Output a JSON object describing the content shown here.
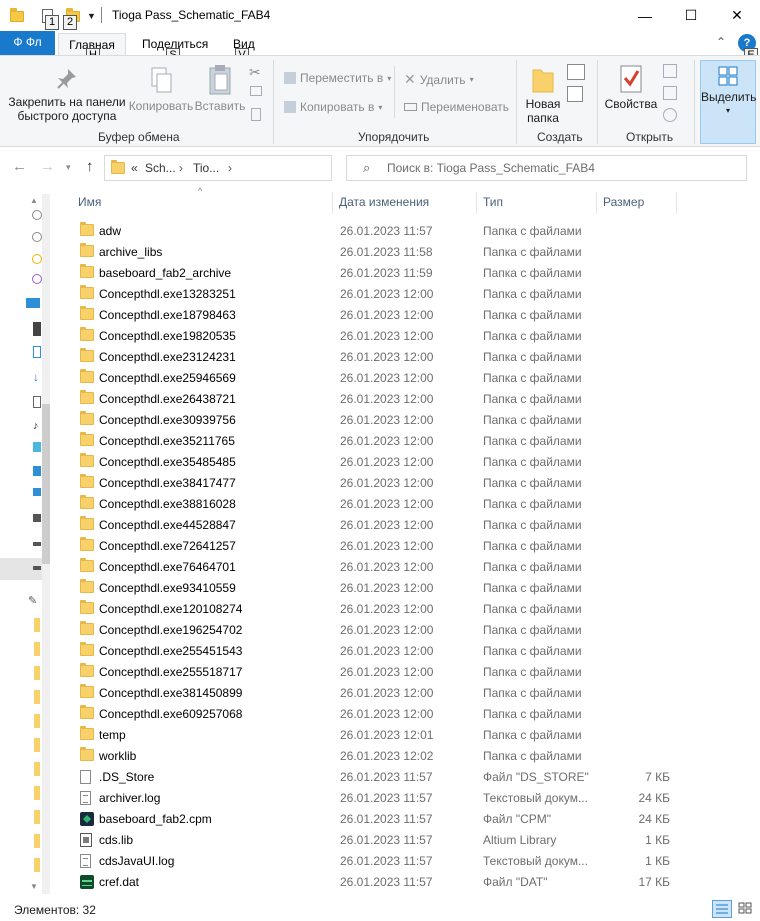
{
  "window": {
    "title": "Tioga Pass_Schematic_FAB4",
    "keytips": [
      "1",
      "2"
    ],
    "minimize": "—",
    "maximize": "☐",
    "close": "✕"
  },
  "ribbon_tabs": {
    "file": "Ф Фл",
    "home": "Главная",
    "home_key": "H",
    "share": "Поделиться",
    "share_key": "S",
    "view": "Вид",
    "view_key": "V",
    "help_key": "E"
  },
  "ribbon": {
    "pin": "Закрепить на панели быстрого доступа",
    "copy": "Копировать",
    "paste": "Вставить",
    "clipboard_group": "Буфер обмена",
    "move_to": "Переместить в",
    "copy_to": "Копировать в",
    "delete": "Удалить",
    "rename": "Переименовать",
    "organize_group": "Упорядочить",
    "new_folder": "Новая папка",
    "create_group": "Создать",
    "properties": "Свойства",
    "open_group": "Открыть",
    "select": "Выделить"
  },
  "navigation": {
    "breadcrumb_overflow": "«",
    "crumbs": [
      "Sch...",
      "Tio..."
    ],
    "search_placeholder": "Поиск в: Tioga Pass_Schematic_FAB4"
  },
  "columns": {
    "name": "Имя",
    "date": "Дата изменения",
    "type": "Тип",
    "size": "Размер"
  },
  "files": [
    {
      "name": "adw",
      "date": "26.01.2023 11:57",
      "type": "Папка с файлами",
      "size": "",
      "icon": "folder"
    },
    {
      "name": "archive_libs",
      "date": "26.01.2023 11:58",
      "type": "Папка с файлами",
      "size": "",
      "icon": "folder"
    },
    {
      "name": "baseboard_fab2_archive",
      "date": "26.01.2023 11:59",
      "type": "Папка с файлами",
      "size": "",
      "icon": "folder"
    },
    {
      "name": "Concepthdl.exe13283251",
      "date": "26.01.2023 12:00",
      "type": "Папка с файлами",
      "size": "",
      "icon": "folder"
    },
    {
      "name": "Concepthdl.exe18798463",
      "date": "26.01.2023 12:00",
      "type": "Папка с файлами",
      "size": "",
      "icon": "folder"
    },
    {
      "name": "Concepthdl.exe19820535",
      "date": "26.01.2023 12:00",
      "type": "Папка с файлами",
      "size": "",
      "icon": "folder"
    },
    {
      "name": "Concepthdl.exe23124231",
      "date": "26.01.2023 12:00",
      "type": "Папка с файлами",
      "size": "",
      "icon": "folder"
    },
    {
      "name": "Concepthdl.exe25946569",
      "date": "26.01.2023 12:00",
      "type": "Папка с файлами",
      "size": "",
      "icon": "folder"
    },
    {
      "name": "Concepthdl.exe26438721",
      "date": "26.01.2023 12:00",
      "type": "Папка с файлами",
      "size": "",
      "icon": "folder"
    },
    {
      "name": "Concepthdl.exe30939756",
      "date": "26.01.2023 12:00",
      "type": "Папка с файлами",
      "size": "",
      "icon": "folder"
    },
    {
      "name": "Concepthdl.exe35211765",
      "date": "26.01.2023 12:00",
      "type": "Папка с файлами",
      "size": "",
      "icon": "folder"
    },
    {
      "name": "Concepthdl.exe35485485",
      "date": "26.01.2023 12:00",
      "type": "Папка с файлами",
      "size": "",
      "icon": "folder"
    },
    {
      "name": "Concepthdl.exe38417477",
      "date": "26.01.2023 12:00",
      "type": "Папка с файлами",
      "size": "",
      "icon": "folder"
    },
    {
      "name": "Concepthdl.exe38816028",
      "date": "26.01.2023 12:00",
      "type": "Папка с файлами",
      "size": "",
      "icon": "folder"
    },
    {
      "name": "Concepthdl.exe44528847",
      "date": "26.01.2023 12:00",
      "type": "Папка с файлами",
      "size": "",
      "icon": "folder"
    },
    {
      "name": "Concepthdl.exe72641257",
      "date": "26.01.2023 12:00",
      "type": "Папка с файлами",
      "size": "",
      "icon": "folder"
    },
    {
      "name": "Concepthdl.exe76464701",
      "date": "26.01.2023 12:00",
      "type": "Папка с файлами",
      "size": "",
      "icon": "folder"
    },
    {
      "name": "Concepthdl.exe93410559",
      "date": "26.01.2023 12:00",
      "type": "Папка с файлами",
      "size": "",
      "icon": "folder"
    },
    {
      "name": "Concepthdl.exe120108274",
      "date": "26.01.2023 12:00",
      "type": "Папка с файлами",
      "size": "",
      "icon": "folder"
    },
    {
      "name": "Concepthdl.exe196254702",
      "date": "26.01.2023 12:00",
      "type": "Папка с файлами",
      "size": "",
      "icon": "folder"
    },
    {
      "name": "Concepthdl.exe255451543",
      "date": "26.01.2023 12:00",
      "type": "Папка с файлами",
      "size": "",
      "icon": "folder"
    },
    {
      "name": "Concepthdl.exe255518717",
      "date": "26.01.2023 12:00",
      "type": "Папка с файлами",
      "size": "",
      "icon": "folder"
    },
    {
      "name": "Concepthdl.exe381450899",
      "date": "26.01.2023 12:00",
      "type": "Папка с файлами",
      "size": "",
      "icon": "folder"
    },
    {
      "name": "Concepthdl.exe609257068",
      "date": "26.01.2023 12:00",
      "type": "Папка с файлами",
      "size": "",
      "icon": "folder"
    },
    {
      "name": "temp",
      "date": "26.01.2023 12:01",
      "type": "Папка с файлами",
      "size": "",
      "icon": "folder"
    },
    {
      "name": "worklib",
      "date": "26.01.2023 12:02",
      "type": "Папка с файлами",
      "size": "",
      "icon": "folder"
    },
    {
      "name": ".DS_Store",
      "date": "26.01.2023 11:57",
      "type": "Файл \"DS_STORE\"",
      "size": "7 КБ",
      "icon": "file"
    },
    {
      "name": "archiver.log",
      "date": "26.01.2023 11:57",
      "type": "Текстовый докум...",
      "size": "24 КБ",
      "icon": "text"
    },
    {
      "name": "baseboard_fab2.cpm",
      "date": "26.01.2023 11:57",
      "type": "Файл \"CPM\"",
      "size": "24 КБ",
      "icon": "app"
    },
    {
      "name": "cds.lib",
      "date": "26.01.2023 11:57",
      "type": "Altium Library",
      "size": "1 КБ",
      "icon": "lib"
    },
    {
      "name": "cdsJavaUI.log",
      "date": "26.01.2023 11:57",
      "type": "Текстовый докум...",
      "size": "1 КБ",
      "icon": "text"
    },
    {
      "name": "cref.dat",
      "date": "26.01.2023 11:57",
      "type": "Файл \"DAT\"",
      "size": "17 КБ",
      "icon": "dat"
    }
  ],
  "status": {
    "items_count": "Элементов: 32"
  },
  "colors": {
    "file_tab": "#1979ca",
    "folder": "#f8d16a",
    "header_text": "#4c607a"
  }
}
